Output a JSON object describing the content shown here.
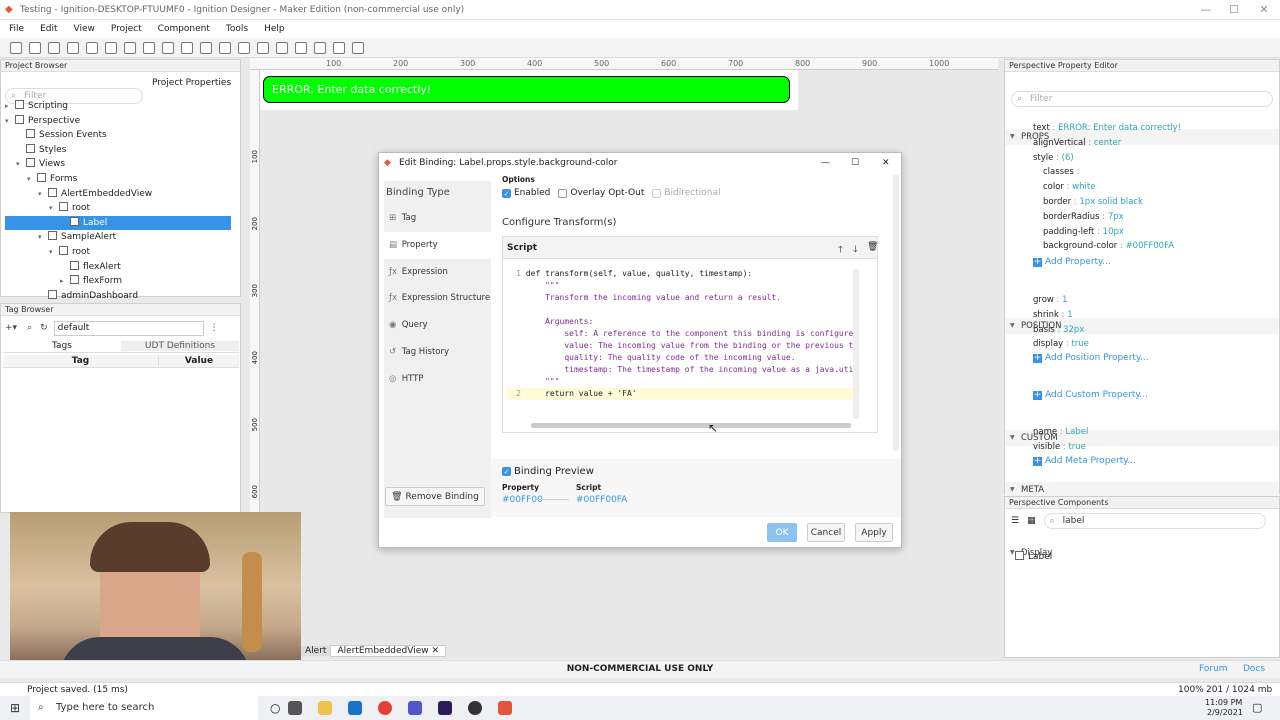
{
  "window": {
    "title": "Testing - Ignition-DESKTOP-FTUUMF0 - Ignition Designer - Maker Edition (non-commercial use only)",
    "min": "—",
    "max": "☐",
    "close": "✕"
  },
  "menu": [
    "File",
    "Edit",
    "View",
    "Project",
    "Component",
    "Tools",
    "Help"
  ],
  "project_browser": {
    "title": "Project Browser",
    "filter_placeholder": "Filter",
    "properties_btn": "Project Properties",
    "tree": [
      {
        "label": "Scripting",
        "depth": 0,
        "caret": "▸"
      },
      {
        "label": "Perspective",
        "depth": 0,
        "caret": "▾"
      },
      {
        "label": "Session Events",
        "depth": 1,
        "caret": ""
      },
      {
        "label": "Styles",
        "depth": 1,
        "caret": ""
      },
      {
        "label": "Views",
        "depth": 1,
        "caret": "▾"
      },
      {
        "label": "Forms",
        "depth": 2,
        "caret": "▾"
      },
      {
        "label": "AlertEmbeddedView",
        "depth": 3,
        "caret": "▾"
      },
      {
        "label": "root",
        "depth": 4,
        "caret": "▾"
      },
      {
        "label": "Label",
        "depth": 5,
        "caret": "",
        "selected": true
      },
      {
        "label": "SampleAlert",
        "depth": 3,
        "caret": "▾"
      },
      {
        "label": "root",
        "depth": 4,
        "caret": "▾"
      },
      {
        "label": "flexAlert",
        "depth": 5,
        "caret": ""
      },
      {
        "label": "flexForm",
        "depth": 5,
        "caret": "▸"
      },
      {
        "label": "adminDashboard",
        "depth": 3,
        "caret": ""
      }
    ]
  },
  "tag_browser": {
    "title": "Tag Browser",
    "provider": "default",
    "tabs": [
      "Tags",
      "UDT Definitions"
    ],
    "columns": [
      "Tag",
      "Value"
    ]
  },
  "canvas": {
    "ruler_x": [
      "100",
      "200",
      "300",
      "400",
      "500",
      "600",
      "700",
      "800",
      "900",
      "1000"
    ],
    "ruler_y": [
      "100",
      "200",
      "300",
      "400",
      "500",
      "600"
    ],
    "error_text": "ERROR: Enter data correctly!",
    "tabs": [
      "Alert",
      "AlertEmbeddedView"
    ]
  },
  "dialog": {
    "title": "Edit Binding: Label.props.style.background-color",
    "binding_type_label": "Binding Type",
    "types": [
      {
        "icon": "⊞",
        "label": "Tag"
      },
      {
        "icon": "▤",
        "label": "Property"
      },
      {
        "icon": "ƒx",
        "label": "Expression"
      },
      {
        "icon": "ƒx",
        "label": "Expression Structure"
      },
      {
        "icon": "◉",
        "label": "Query"
      },
      {
        "icon": "↺",
        "label": "Tag History"
      },
      {
        "icon": "◎",
        "label": "HTTP"
      }
    ],
    "remove_binding": "Remove Binding",
    "options_label": "Options",
    "enabled": "Enabled",
    "overlay": "Overlay Opt-Out",
    "bidirectional": "Bidirectional",
    "configure": "Configure Transform(s)",
    "script_label": "Script",
    "code": [
      {
        "n": "1",
        "text": "def transform(self, value, quality, timestamp):"
      },
      {
        "n": "",
        "text": "    \"\"\""
      },
      {
        "n": "",
        "text": "    Transform the incoming value and return a result."
      },
      {
        "n": "",
        "text": ""
      },
      {
        "n": "",
        "text": "    Arguments:"
      },
      {
        "n": "",
        "text": "        self: A reference to the component this binding is configured o"
      },
      {
        "n": "",
        "text": "        value: The incoming value from the binding or the previous tran"
      },
      {
        "n": "",
        "text": "        quality: The quality code of the incoming value."
      },
      {
        "n": "",
        "text": "        timestamp: The timestamp of the incoming value as a java.util.D"
      },
      {
        "n": "",
        "text": "    \"\"\""
      },
      {
        "n": "2",
        "text": "    return value + 'FA'"
      }
    ],
    "preview_label": "Binding Preview",
    "property_label": "Property",
    "property_value": "#00FF00",
    "script_col_label": "Script",
    "script_value": "#00FF00FA",
    "ok": "OK",
    "cancel": "Cancel",
    "apply": "Apply"
  },
  "property_editor": {
    "title": "Perspective Property Editor",
    "filter_placeholder": "Filter",
    "props_header": "PROPS",
    "props": [
      {
        "k": "text",
        "v": "ERROR: Enter data correctly!",
        "indent": 0
      },
      {
        "k": "alignVertical",
        "v": "center",
        "indent": 0
      },
      {
        "k": "style",
        "v": "(6)",
        "indent": 0
      },
      {
        "k": "classes",
        "v": "",
        "indent": 1
      },
      {
        "k": "color",
        "v": "white",
        "indent": 1
      },
      {
        "k": "border",
        "v": "1px solid black",
        "indent": 1
      },
      {
        "k": "borderRadius",
        "v": "7px",
        "indent": 1
      },
      {
        "k": "padding-left",
        "v": "10px",
        "indent": 1
      },
      {
        "k": "background-color",
        "v": "#00FF00FA",
        "indent": 1
      }
    ],
    "add_property": "Add Property...",
    "position_header": "POSITION",
    "position": [
      {
        "k": "grow",
        "v": "1"
      },
      {
        "k": "shrink",
        "v": "1"
      },
      {
        "k": "basis",
        "v": "32px"
      },
      {
        "k": "display",
        "v": "true"
      }
    ],
    "add_position": "Add Position Property...",
    "custom_header": "CUSTOM",
    "add_custom": "Add Custom Property...",
    "meta_header": "META",
    "meta": [
      {
        "k": "name",
        "v": "Label"
      },
      {
        "k": "visible",
        "v": "true"
      }
    ],
    "add_meta": "Add Meta Property..."
  },
  "components": {
    "title": "Perspective Components",
    "search": "label",
    "group": "Display",
    "item": "Label"
  },
  "status": {
    "left": "Project saved. (15 ms)",
    "center": "NON-COMMERCIAL USE ONLY",
    "zoom": "100%",
    "memory": "201 / 1024 mb",
    "forum": "Forum",
    "docs": "Docs"
  },
  "taskbar": {
    "search": "Type here to search",
    "time": "11:09 PM",
    "date": "2/9/2021"
  },
  "colors": {
    "accent": "#3793e6",
    "error_bg": "#00ff00",
    "value_text": "#2ca6b6"
  }
}
